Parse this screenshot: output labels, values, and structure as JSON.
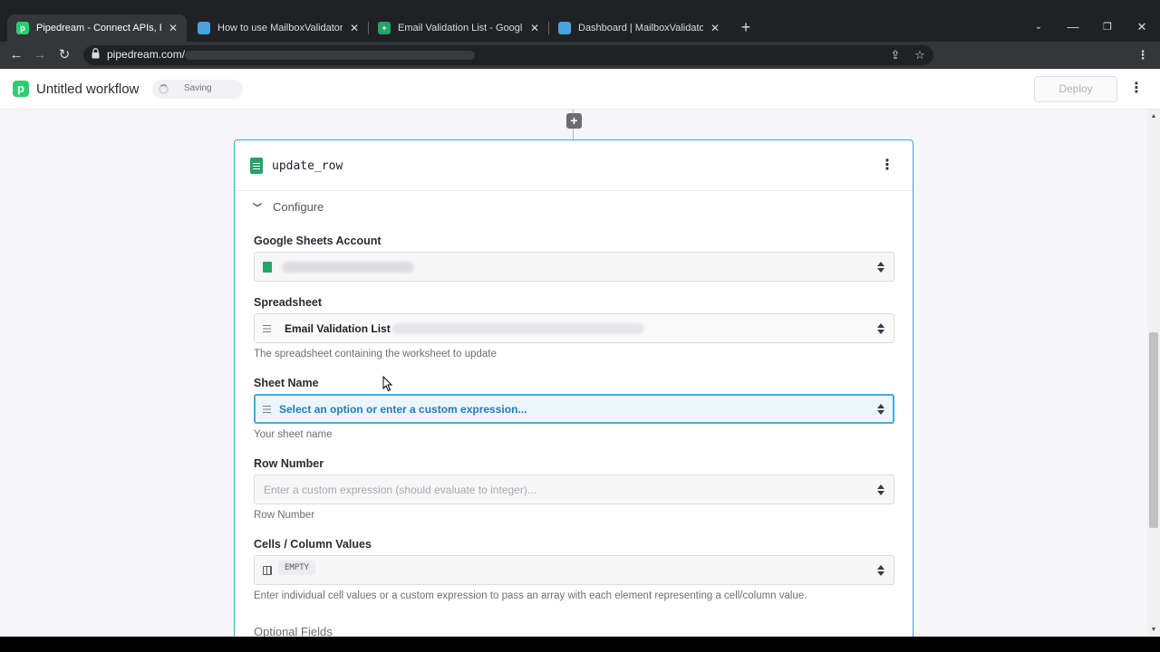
{
  "browser": {
    "tabs": [
      {
        "title": "Pipedream - Connect APIs, Rema",
        "icon": "pipedream-favicon",
        "color": "#2ecc71",
        "active": true
      },
      {
        "title": "How to use MailboxValidator to v",
        "icon": "mailboxvalidator-favicon",
        "color": "#4aa3df",
        "active": false
      },
      {
        "title": "Email Validation List - Google Sh",
        "icon": "google-sheets-favicon",
        "color": "#23a566",
        "active": false
      },
      {
        "title": "Dashboard | MailboxValidator",
        "icon": "mailboxvalidator-favicon",
        "color": "#4aa3df",
        "active": false
      }
    ],
    "url": "pipedream.com/"
  },
  "app": {
    "workflow_title": "Untitled workflow",
    "saving_label": "Saving",
    "deploy_label": "Deploy"
  },
  "step": {
    "name": "update_row",
    "configure_label": "Configure",
    "fields": {
      "account": {
        "label": "Google Sheets Account"
      },
      "spreadsheet": {
        "label": "Spreadsheet",
        "value": "Email Validation List",
        "hint": "The spreadsheet containing the worksheet to update"
      },
      "sheet_name": {
        "label": "Sheet Name",
        "placeholder": "Select an option or enter a custom expression...",
        "hint": "Your sheet name"
      },
      "row_number": {
        "label": "Row Number",
        "placeholder": "Enter a custom expression (should evaluate to integer)...",
        "hint": "Row Number"
      },
      "cells": {
        "label": "Cells / Column Values",
        "value": "EMPTY",
        "hint": "Enter individual cell values or a custom expression to pass an array with each element representing a cell/column value."
      }
    },
    "optional_fields_label": "Optional Fields"
  },
  "colors": {
    "accent": "#4aa8de",
    "brand": "#2ecc71",
    "sheets_green": "#23a566"
  }
}
